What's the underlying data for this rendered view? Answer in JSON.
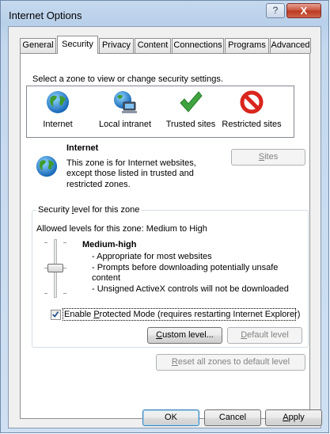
{
  "window": {
    "title": "Internet Options",
    "help_button": "?",
    "close_button": "X"
  },
  "tabs": [
    {
      "label": "General",
      "active": false
    },
    {
      "label": "Security",
      "active": true
    },
    {
      "label": "Privacy",
      "active": false
    },
    {
      "label": "Content",
      "active": false
    },
    {
      "label": "Connections",
      "active": false
    },
    {
      "label": "Programs",
      "active": false
    },
    {
      "label": "Advanced",
      "active": false
    }
  ],
  "security": {
    "select_zone_prompt": "Select a zone to view or change security settings.",
    "zones": [
      {
        "label": "Internet",
        "icon": "globe-icon",
        "selected": true
      },
      {
        "label": "Local intranet",
        "icon": "intranet-icon",
        "selected": false
      },
      {
        "label": "Trusted sites",
        "icon": "checkmark-icon",
        "selected": false
      },
      {
        "label": "Restricted sites",
        "icon": "no-entry-icon",
        "selected": false
      }
    ],
    "selected_zone": {
      "title": "Internet",
      "description_line1": "This zone is for Internet websites,",
      "description_line2": "except those listed in trusted and",
      "description_line3": "restricted zones."
    },
    "sites_button": {
      "prefix": "",
      "mnemonic": "S",
      "suffix": "ites",
      "enabled": false
    },
    "level_group": {
      "title_prefix": "Security ",
      "title_mnemonic": "l",
      "title_suffix": "evel for this zone",
      "allowed_levels": "Allowed levels for this zone: Medium to High",
      "level_name": "Medium-high",
      "bullet1": "- Appropriate for most websites",
      "bullet2": "- Prompts before downloading potentially unsafe",
      "bullet2_cont": "content",
      "bullet3": "- Unsigned ActiveX controls will not be downloaded"
    },
    "protected_mode": {
      "checked": true,
      "prefix": "Enable ",
      "mnemonic": "P",
      "suffix": "rotected Mode (requires restarting Internet Explorer)"
    },
    "custom_level_button": {
      "prefix": "",
      "mnemonic": "C",
      "suffix": "ustom level...",
      "enabled": true
    },
    "default_level_button": {
      "prefix": "",
      "mnemonic": "D",
      "suffix": "efault level",
      "enabled": false
    },
    "reset_button": {
      "prefix": "",
      "mnemonic": "R",
      "suffix": "eset all zones to default level",
      "enabled": false
    }
  },
  "footer": {
    "ok_label": "OK",
    "cancel_label": "Cancel",
    "apply_prefix": "",
    "apply_mnemonic": "A",
    "apply_suffix": "pply"
  },
  "colors": {
    "title_bar": "#b9d0ea",
    "close_button": "#c7503a",
    "checkmark": "#3fa33f",
    "no_entry": "#d9251d",
    "default_button_border": "#3c7fb1"
  }
}
